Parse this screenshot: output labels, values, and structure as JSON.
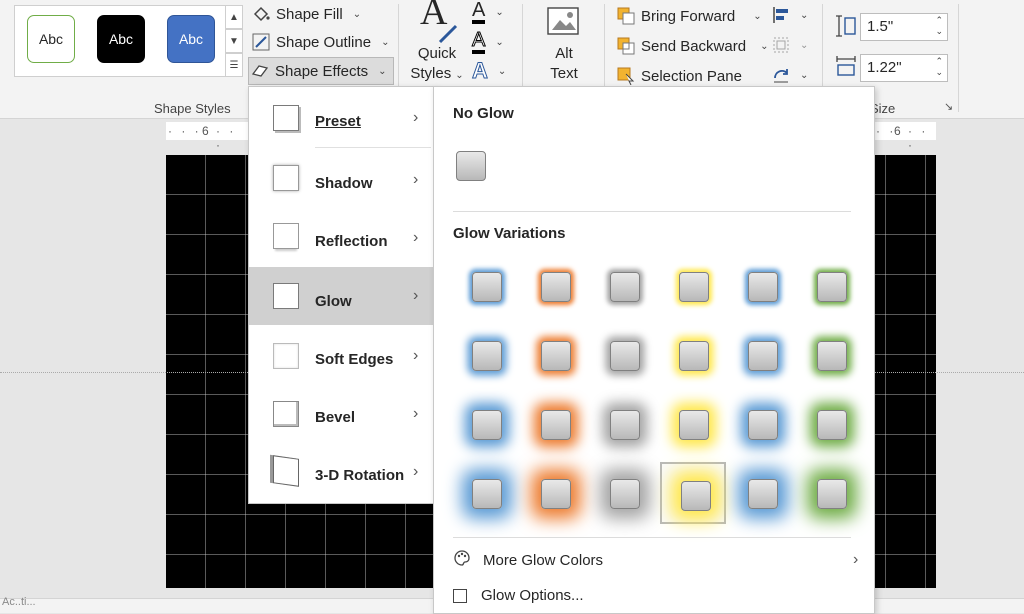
{
  "shape_styles": {
    "swatches": [
      {
        "label": "Abc",
        "fill": "#ffffff",
        "border": "#70ad47",
        "text": "#262626"
      },
      {
        "label": "Abc",
        "fill": "#000000",
        "border": "#000000",
        "text": "#ffffff"
      },
      {
        "label": "Abc",
        "fill": "#4472c4",
        "border": "#2f5597",
        "text": "#ffffff"
      }
    ],
    "group_label": "Shape Styles"
  },
  "shape_format": {
    "fill_label": "Shape Fill",
    "outline_label": "Shape Outline",
    "effects_label": "Shape Effects"
  },
  "wordart": {
    "quick_styles_line1": "Quick",
    "quick_styles_line2": "Styles",
    "text_fill_letter": "A",
    "text_outline_letter": "A",
    "text_effects_letter": "A"
  },
  "accessibility": {
    "alt_text_line1": "Alt",
    "alt_text_line2": "Text"
  },
  "arrange": {
    "bring_forward": "Bring Forward",
    "send_backward": "Send Backward",
    "selection_pane": "Selection Pane"
  },
  "size": {
    "height_value": "1.5\"",
    "width_value": "1.22\"",
    "group_label_partial": "Size"
  },
  "ruler": {
    "left_mark": "6",
    "right_mark": "6"
  },
  "status": {
    "left_text": "Ac..ti..."
  },
  "effects_menu": {
    "items": [
      {
        "label": "Preset",
        "icon": "preset-icon"
      },
      {
        "label": "Shadow",
        "icon": "shadow-icon"
      },
      {
        "label": "Reflection",
        "icon": "reflection-icon"
      },
      {
        "label": "Glow",
        "icon": "glow-icon"
      },
      {
        "label": "Soft Edges",
        "icon": "soft-edges-icon"
      },
      {
        "label": "Bevel",
        "icon": "bevel-icon"
      },
      {
        "label": "3-D Rotation",
        "icon": "3d-rotation-icon"
      }
    ],
    "active_item": "Glow"
  },
  "glow_submenu": {
    "no_glow_heading": "No Glow",
    "variations_heading": "Glow Variations",
    "colors": [
      "#5b9bd5",
      "#ed7d31",
      "#a5a5a5",
      "#ffe84d",
      "#5b9bd5",
      "#70ad47"
    ],
    "glow_sizes": [
      3,
      5,
      8,
      11
    ],
    "selected": {
      "row": 4,
      "column": 4
    },
    "more_colors": "More Glow Colors",
    "options": "Glow Options..."
  }
}
